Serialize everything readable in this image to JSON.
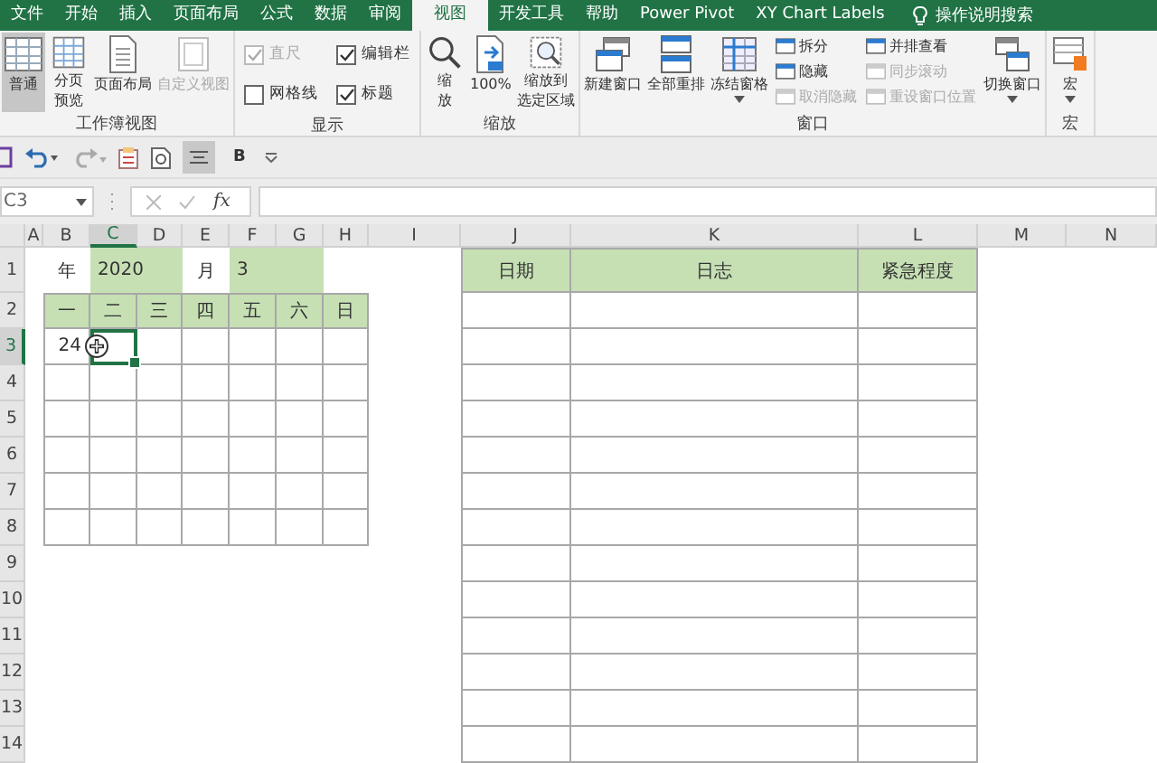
{
  "tabs": [
    {
      "label": "文件",
      "selected": false
    },
    {
      "label": "开始",
      "selected": false
    },
    {
      "label": "插入",
      "selected": false
    },
    {
      "label": "页面布局",
      "selected": false
    },
    {
      "label": "公式",
      "selected": false
    },
    {
      "label": "数据",
      "selected": false
    },
    {
      "label": "审阅",
      "selected": false
    },
    {
      "label": "视图",
      "selected": true
    },
    {
      "label": "开发工具",
      "selected": false
    },
    {
      "label": "帮助",
      "selected": false
    },
    {
      "label": "Power Pivot",
      "selected": false
    },
    {
      "label": "XY Chart Labels",
      "selected": false
    }
  ],
  "search": {
    "label": "操作说明搜索"
  },
  "ribbon_groups": [
    {
      "label": "工作簿视图",
      "items": [
        {
          "kind": "large",
          "lines": [
            "普通"
          ],
          "selected": true,
          "disabled": false
        },
        {
          "kind": "large",
          "lines": [
            "分页",
            "预览"
          ],
          "selected": false,
          "disabled": false
        },
        {
          "kind": "large",
          "lines": [
            "页面布局"
          ],
          "selected": false,
          "disabled": false
        },
        {
          "kind": "large",
          "lines": [
            "自定义视图"
          ],
          "selected": false,
          "disabled": true
        }
      ]
    },
    {
      "label": "显示",
      "items": [
        {
          "kind": "checkbox",
          "label": "直尺",
          "checked": true,
          "disabled": true
        },
        {
          "kind": "checkbox",
          "label": "编辑栏",
          "checked": true,
          "disabled": false
        },
        {
          "kind": "checkbox",
          "label": "网格线",
          "checked": false,
          "disabled": false
        },
        {
          "kind": "checkbox",
          "label": "标题",
          "checked": true,
          "disabled": false
        }
      ]
    },
    {
      "label": "缩放",
      "items": [
        {
          "kind": "large",
          "lines": [
            "缩",
            "放"
          ],
          "selected": false,
          "disabled": false
        },
        {
          "kind": "large",
          "lines": [
            "100%"
          ],
          "selected": false,
          "disabled": false
        },
        {
          "kind": "large",
          "lines": [
            "缩放到",
            "选定区域"
          ],
          "selected": false,
          "disabled": false
        }
      ]
    },
    {
      "label": "窗口",
      "items": [
        {
          "kind": "large",
          "lines": [
            "新建窗口"
          ],
          "selected": false,
          "disabled": false
        },
        {
          "kind": "large",
          "lines": [
            "全部重排"
          ],
          "selected": false,
          "disabled": false
        },
        {
          "kind": "large",
          "lines": [
            "冻结窗格"
          ],
          "selected": false,
          "disabled": false,
          "dropdown": true
        },
        {
          "kind": "small",
          "label": "拆分",
          "disabled": false
        },
        {
          "kind": "small",
          "label": "隐藏",
          "disabled": false
        },
        {
          "kind": "small",
          "label": "取消隐藏",
          "disabled": true
        },
        {
          "kind": "small",
          "label": "并排查看",
          "disabled": false
        },
        {
          "kind": "small",
          "label": "同步滚动",
          "disabled": true
        },
        {
          "kind": "small",
          "label": "重设窗口位置",
          "disabled": true
        },
        {
          "kind": "large",
          "lines": [
            "切换窗口"
          ],
          "selected": false,
          "disabled": false,
          "dropdown": true
        }
      ]
    },
    {
      "label": "宏",
      "items": [
        {
          "kind": "large",
          "lines": [
            "宏"
          ],
          "selected": false,
          "disabled": false,
          "dropdown": true
        }
      ]
    }
  ],
  "quick_access": {
    "bold_button": "B"
  },
  "formula_bar": {
    "name_box": "C3",
    "function_button": "fx"
  },
  "sheet": {
    "columns": [
      {
        "label": "A",
        "selected": false
      },
      {
        "label": "B",
        "selected": false
      },
      {
        "label": "C",
        "selected": true
      },
      {
        "label": "D",
        "selected": false
      },
      {
        "label": "E",
        "selected": false
      },
      {
        "label": "F",
        "selected": false
      },
      {
        "label": "G",
        "selected": false
      },
      {
        "label": "H",
        "selected": false
      },
      {
        "label": "I",
        "selected": false
      },
      {
        "label": "J",
        "selected": false
      },
      {
        "label": "K",
        "selected": false
      },
      {
        "label": "L",
        "selected": false
      },
      {
        "label": "M",
        "selected": false
      },
      {
        "label": "N",
        "selected": false
      }
    ],
    "rows": [
      {
        "label": "1",
        "selected": false
      },
      {
        "label": "2",
        "selected": false
      },
      {
        "label": "3",
        "selected": true
      },
      {
        "label": "4",
        "selected": false
      },
      {
        "label": "5",
        "selected": false
      },
      {
        "label": "6",
        "selected": false
      },
      {
        "label": "7",
        "selected": false
      },
      {
        "label": "8",
        "selected": false
      },
      {
        "label": "9",
        "selected": false
      },
      {
        "label": "10",
        "selected": false
      },
      {
        "label": "11",
        "selected": false
      },
      {
        "label": "12",
        "selected": false
      },
      {
        "label": "13",
        "selected": false
      },
      {
        "label": "14",
        "selected": false
      }
    ],
    "calendar": {
      "year_label": "年",
      "year": "2020",
      "month_label": "月",
      "month": "3",
      "weekdays": [
        "一",
        "二",
        "三",
        "四",
        "五",
        "六",
        "日"
      ],
      "dates": [
        "24"
      ]
    },
    "log_table": {
      "columns": [
        "日期",
        "日志",
        "紧急程度"
      ]
    }
  }
}
